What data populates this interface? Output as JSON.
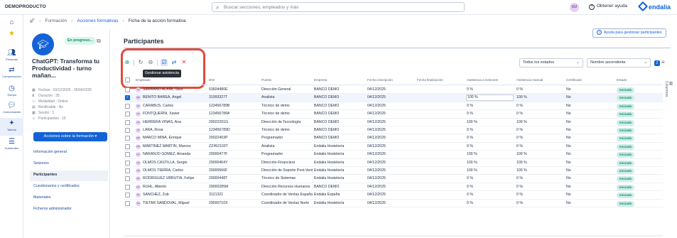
{
  "topbar": {
    "org": "DEMOPRODUCTO",
    "search_placeholder": "Buscar secciones, empleados y más",
    "user_initials": "UU",
    "help_label": "Obtener ayuda",
    "brand": "endalia"
  },
  "leftnav": [
    {
      "icon": "home-icon",
      "label": ""
    },
    {
      "icon": "star-icon",
      "label": ""
    },
    {
      "icon": "people-icon",
      "label": "Personas"
    },
    {
      "icon": "compensation-icon",
      "label": "Compensación"
    },
    {
      "icon": "clock-icon",
      "label": "Tiempo"
    },
    {
      "icon": "chat-icon",
      "label": "Comunicación"
    },
    {
      "icon": "talent-icon",
      "label": "Talento"
    },
    {
      "icon": "requests-icon",
      "label": "Solicitudes"
    }
  ],
  "breadcrumb": {
    "items": [
      "Formación",
      "Acciones formativas",
      "Ficha de la acción formativa"
    ]
  },
  "course": {
    "status": "En progreso...",
    "title": "ChatGPT: Transforma tu Productividad - turno mañan...",
    "meta": [
      {
        "icon": "calendar-icon",
        "text": "Fechas : 03/12/2025 - 06/04/2026"
      },
      {
        "icon": "hourglass-icon",
        "text": "Duración : 35"
      },
      {
        "icon": "monitor-icon",
        "text": "Modalidad : Online"
      },
      {
        "icon": "money-icon",
        "text": "Bonificable : No"
      },
      {
        "icon": "calendar-icon",
        "text": "Sesión : 1"
      },
      {
        "icon": "people-icon",
        "text": "Participantes : 15"
      }
    ],
    "actions_button": "Acciones sobre la formación ▾",
    "menu": [
      "Información general",
      "Sesiones",
      "Participantes",
      "Cuestionarios y certificados",
      "Materiales",
      "Ficheros administrador"
    ],
    "menu_active_index": 2
  },
  "main": {
    "title": "Participantes",
    "help_button": "Ayuda para gestionar participantes",
    "tooltip": "Gestionar asistencia",
    "filter_state": "Todos los estados",
    "sort": "Nombre ascendente",
    "filter_count": "2",
    "columns_label": "Columnas"
  },
  "table": {
    "headers": [
      "Empleado",
      "DNI",
      "Puesto",
      "Empresa",
      "Fecha inscripción",
      "Fecha finalización",
      "Asistencia a sesiones",
      "Asistencia manual",
      "Certificado",
      "Estado"
    ],
    "rows": [
      {
        "initials": "SS",
        "name": "SERRANO ALAMI, Sara",
        "dni": "53604480E",
        "puesto": "Dirección General",
        "empresa": "BANCO DEMO",
        "inscripcion": "04/12/2025",
        "fin": "",
        "asist": "0 %",
        "manual": "0 %",
        "cert": "No",
        "estado": "Iniciado",
        "checked": false
      },
      {
        "initials": "BB",
        "name": "BENITO BAREA, Ángel",
        "dni": "31993327T",
        "puesto": "Analista",
        "empresa": "BANCO DEMO",
        "inscripcion": "04/12/2025",
        "fin": "",
        "asist": "100 %",
        "manual": "100 %",
        "cert": "No",
        "estado": "Iniciado",
        "checked": true
      },
      {
        "initials": "CC",
        "name": "CARABUS, Carlos",
        "dni": "123456789B",
        "puesto": "Técnico de demo",
        "empresa": "BANCO DEMO",
        "inscripcion": "04/12/2025",
        "fin": "",
        "asist": "0 %",
        "manual": "0 %",
        "cert": "No",
        "estado": "Iniciado",
        "checked": false
      },
      {
        "initials": "FX",
        "name": "FONTQUERNI, Xavier",
        "dni": "123456789A",
        "puesto": "Técnico de demo",
        "empresa": "BANCO DEMO",
        "inscripcion": "04/12/2025",
        "fin": "",
        "asist": "0 %",
        "manual": "0 %",
        "cert": "No",
        "estado": "Iniciado",
        "checked": false
      },
      {
        "initials": "HA",
        "name": "HERRERA VIÑAS, Ana",
        "dni": "29022201G",
        "puesto": "Dirección de Tecnología",
        "empresa": "BANCO DEMO",
        "inscripcion": "04/12/2025",
        "fin": "",
        "asist": "100 %",
        "manual": "100 %",
        "cert": "No",
        "estado": "Iniciado",
        "checked": false
      },
      {
        "initials": "LR",
        "name": "LARA, Rosa",
        "dni": "123456789D",
        "puesto": "Técnico de demo",
        "empresa": "BANCO DEMO",
        "inscripcion": "04/12/2025",
        "fin": "",
        "asist": "0 %",
        "manual": "0 %",
        "cert": "No",
        "estado": "Iniciado",
        "checked": false
      },
      {
        "initials": "MM",
        "name": "MARCO MINA, Enrique",
        "dni": "29022403P",
        "puesto": "Programador",
        "empresa": "BANCO DEMO",
        "inscripcion": "04/12/2025",
        "fin": "",
        "asist": "0 %",
        "manual": "0 %",
        "cert": "No",
        "estado": "Iniciado",
        "checked": false
      },
      {
        "initials": "MM",
        "name": "MARTÍNEZ MARTÍN, Marcos",
        "dni": "ZZ452103T",
        "puesto": "Analista",
        "empresa": "Endalia Hostelería",
        "inscripcion": "04/12/2025",
        "fin": "",
        "asist": "0 %",
        "manual": "0 %",
        "cert": "No",
        "estado": "Iniciado",
        "checked": false
      },
      {
        "initials": "NA",
        "name": "NARANJO GÓMEZ, Amanda",
        "dni": "29000477F",
        "puesto": "Programador",
        "empresa": "Endalia Hostelería",
        "inscripcion": "04/12/2025",
        "fin": "",
        "asist": "100 %",
        "manual": "100 %",
        "cert": "No",
        "estado": "Iniciado",
        "checked": false
      },
      {
        "initials": "OS",
        "name": "OLMOS CASTILLA, Sergio",
        "dni": "29000464Y",
        "puesto": "Dirección Financiera",
        "empresa": "Endalia Hostelería",
        "inscripcion": "04/12/2025",
        "fin": "",
        "asist": "100 %",
        "manual": "100 %",
        "cert": "No",
        "estado": "Iniciado",
        "checked": false
      },
      {
        "initials": "OS",
        "name": "OLMOS TIERRA, Carlos",
        "dni": "29000560F",
        "puesto": "Dirección de Soporte Post-Venta",
        "empresa": "Endalia Hostelería",
        "inscripcion": "04/12/2025",
        "fin": "",
        "asist": "100 %",
        "manual": "100 %",
        "cert": "No",
        "estado": "Iniciado",
        "checked": false
      },
      {
        "initials": "RF",
        "name": "RODRÍGUEZ UBRUTIA, Felipe",
        "dni": "29000448T",
        "puesto": "Técnico de Sistemas",
        "empresa": "Endalia Hostelería",
        "inscripcion": "04/12/2025",
        "fin": "",
        "asist": "0 %",
        "manual": "0 %",
        "cert": "No",
        "estado": "Iniciado",
        "checked": false
      },
      {
        "initials": "RA",
        "name": "RUHL, Alberto",
        "dni": "29000285M",
        "puesto": "Dirección Recursos Humanos",
        "empresa": "BANCO DEMO",
        "inscripcion": "04/12/2025",
        "fin": "",
        "asist": "0 %",
        "manual": "0 %",
        "cert": "No",
        "estado": "Iniciado",
        "checked": false
      },
      {
        "initials": "SZ",
        "name": "SÁNCHEZ, Zub",
        "dni": "3121321",
        "puesto": "Coordinador de Ventas España",
        "empresa": "Endalia España",
        "inscripcion": "04/12/2025",
        "fin": "",
        "asist": "0 %",
        "manual": "0 %",
        "cert": "No",
        "estado": "Iniciado",
        "checked": false
      },
      {
        "initials": "TM",
        "name": "TIÉTAR SANDOVAL, Miguel",
        "dni": "29000710X",
        "puesto": "Coordinador de Ventas Norte",
        "empresa": "Endalia Hostelería",
        "inscripcion": "04/12/2025",
        "fin": "",
        "asist": "0 %",
        "manual": "0 %",
        "cert": "No",
        "estado": "Iniciado",
        "checked": false
      }
    ]
  },
  "colors": {
    "brand": "#1463d6",
    "highlight": "#e3493b",
    "status_green": "#168a63"
  }
}
